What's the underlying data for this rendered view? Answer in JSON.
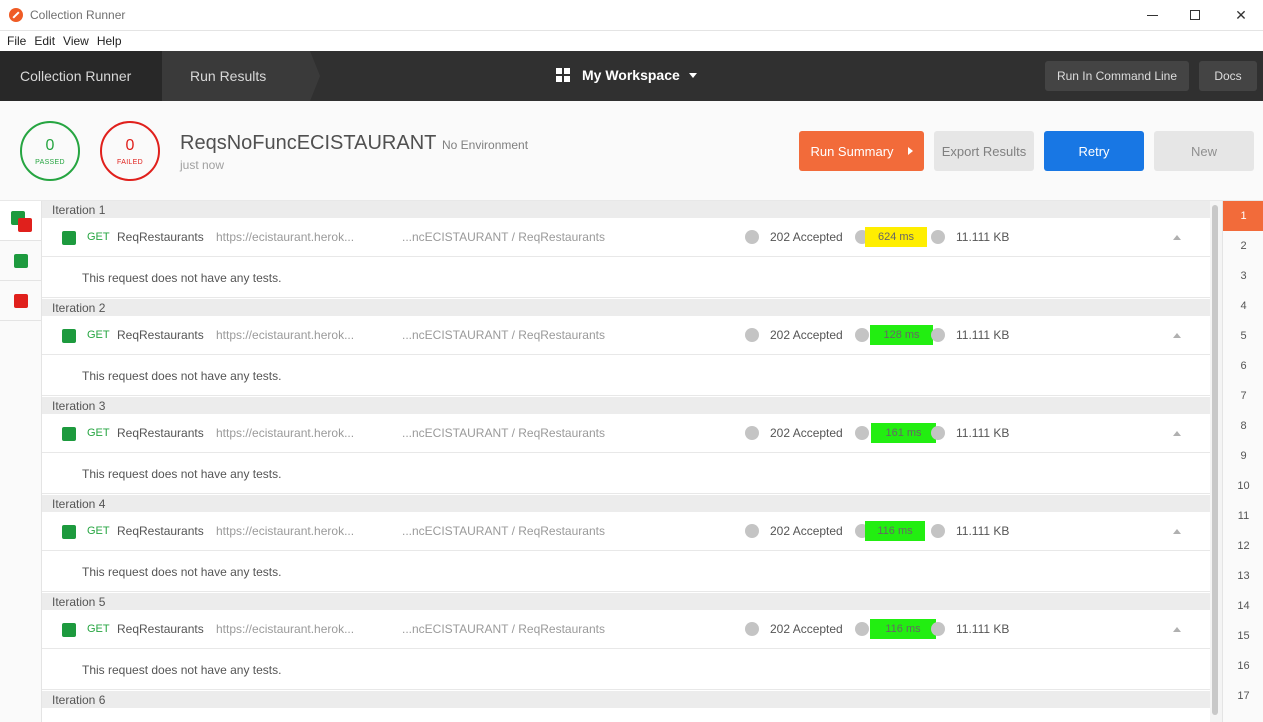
{
  "window": {
    "title": "Collection Runner",
    "minimize": "",
    "maximize": "",
    "close": "✕"
  },
  "menu": [
    "File",
    "Edit",
    "View",
    "Help"
  ],
  "nav": {
    "tab_runner": "Collection Runner",
    "tab_results": "Run Results",
    "workspace": "My Workspace",
    "run_cmd": "Run In Command Line",
    "docs": "Docs"
  },
  "summary": {
    "passed_count": "0",
    "passed_label": "PASSED",
    "failed_count": "0",
    "failed_label": "FAILED",
    "collection_name": "ReqsNoFuncECISTAURANT",
    "environment": "No Environment",
    "time": "just now",
    "btn_run_summary": "Run Summary",
    "btn_export": "Export Results",
    "btn_retry": "Retry",
    "btn_new": "New"
  },
  "iterations": [
    {
      "label": "Iteration 1",
      "method": "GET",
      "name": "ReqRestaurants",
      "url": "https://ecistaurant.herok...",
      "path": "...ncECISTAURANT / ReqRestaurants",
      "status": "202 Accepted",
      "time": "624 ms",
      "size": "11.111 KB",
      "tests": "This request does not have any tests.",
      "highlight": "yellow"
    },
    {
      "label": "Iteration 2",
      "method": "GET",
      "name": "ReqRestaurants",
      "url": "https://ecistaurant.herok...",
      "path": "...ncECISTAURANT / ReqRestaurants",
      "status": "202 Accepted",
      "time": "128 ms",
      "size": "11.111 KB",
      "tests": "This request does not have any tests.",
      "highlight": "green"
    },
    {
      "label": "Iteration 3",
      "method": "GET",
      "name": "ReqRestaurants",
      "url": "https://ecistaurant.herok...",
      "path": "...ncECISTAURANT / ReqRestaurants",
      "status": "202 Accepted",
      "time": "161 ms",
      "size": "11.111 KB",
      "tests": "This request does not have any tests.",
      "highlight": "green"
    },
    {
      "label": "Iteration 4",
      "method": "GET",
      "name": "ReqRestaurants",
      "url": "https://ecistaurant.herok...",
      "path": "...ncECISTAURANT / ReqRestaurants",
      "status": "202 Accepted",
      "time": "116 ms",
      "size": "11.111 KB",
      "tests": "This request does not have any tests.",
      "highlight": "green"
    },
    {
      "label": "Iteration 5",
      "method": "GET",
      "name": "ReqRestaurants",
      "url": "https://ecistaurant.herok...",
      "path": "...ncECISTAURANT / ReqRestaurants",
      "status": "202 Accepted",
      "time": "116 ms",
      "size": "11.111 KB",
      "tests": "This request does not have any tests.",
      "highlight": "green"
    },
    {
      "label": "Iteration 6"
    }
  ],
  "iteration_index": [
    "1",
    "2",
    "3",
    "4",
    "5",
    "6",
    "7",
    "8",
    "9",
    "10",
    "11",
    "12",
    "13",
    "14",
    "15",
    "16",
    "17"
  ],
  "active_iteration": "1",
  "colors": {
    "accent_orange": "#f26b3a",
    "retry_blue": "#1877e4",
    "pass_green": "#26a541",
    "fail_red": "#e0201c",
    "highlight_yellow": "#ffee00",
    "highlight_green": "#22ee11"
  }
}
